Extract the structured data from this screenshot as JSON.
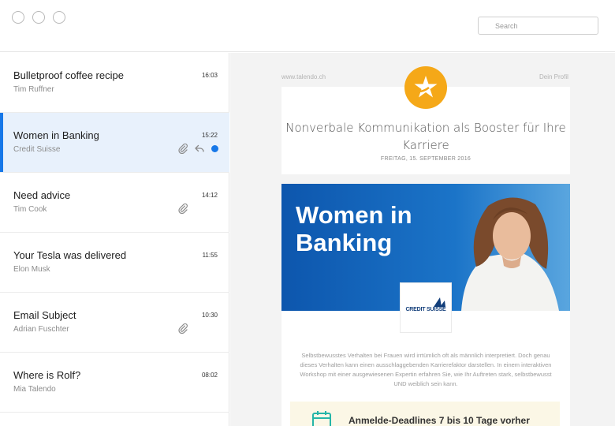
{
  "window": {
    "controls": [
      "close",
      "minimize",
      "maximize"
    ]
  },
  "search": {
    "placeholder": "Search"
  },
  "messages": [
    {
      "subject": "Bulletproof coffee recipe",
      "sender": "Tim Ruffner",
      "time": "16:03",
      "attachment": false,
      "replied": false,
      "unread": false,
      "selected": false
    },
    {
      "subject": "Women in Banking",
      "sender": "Credit Suisse",
      "time": "15:22",
      "attachment": true,
      "replied": true,
      "unread": true,
      "selected": true
    },
    {
      "subject": "Need advice",
      "sender": "Tim Cook",
      "time": "14:12",
      "attachment": true,
      "replied": false,
      "unread": false,
      "selected": false
    },
    {
      "subject": "Your Tesla was delivered",
      "sender": "Elon Musk",
      "time": "11:55",
      "attachment": false,
      "replied": false,
      "unread": false,
      "selected": false
    },
    {
      "subject": "Email Subject",
      "sender": "Adrian Fuschter",
      "time": "10:30",
      "attachment": true,
      "replied": false,
      "unread": false,
      "selected": false
    },
    {
      "subject": "Where is Rolf?",
      "sender": "Mia Talendo",
      "time": "08:02",
      "attachment": false,
      "replied": false,
      "unread": false,
      "selected": false
    }
  ],
  "email": {
    "site_link": "www.talendo.ch",
    "profile_link": "Dein Profil",
    "headline": "Nonverbale Kommunikation als Booster für Ihre Karriere",
    "date": "FREITAG, 15. SEPTEMBER 2016",
    "banner_title": "Women in Banking",
    "sponsor_logo": "CREDIT SUISSE",
    "body": "Selbstbewusstes Verhalten bei Frauen wird irrtümlich oft als männlich interpretiert. Doch genau dieses Verhalten kann einen ausschlaggebenden Karrierefaktor darstellen. In einem interaktiven Workshop mit einer ausgewiesenen Expertin erfahren Sie, wie Ihr Auftreten stark, selbstbewusst UND weiblich sein kann.",
    "deadline": "Anmelde-Deadlines 7 bis 10 Tage vorher"
  },
  "colors": {
    "accent": "#1778e8",
    "selected_bg": "#e8f1fc",
    "banner_blue": "#0b4fa6",
    "star_orange": "#f5a818"
  }
}
